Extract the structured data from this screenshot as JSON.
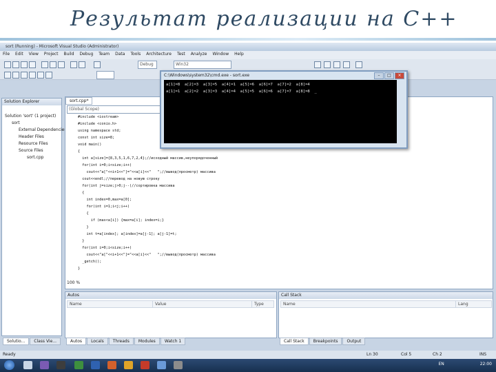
{
  "slide_title": "Результат реализации на С++",
  "window_title": "sort (Running) - Microsoft Visual Studio (Administrator)",
  "menu": [
    "File",
    "Edit",
    "View",
    "Project",
    "Build",
    "Debug",
    "Team",
    "Data",
    "Tools",
    "Architecture",
    "Test",
    "Analyze",
    "Window",
    "Help"
  ],
  "toolbar": {
    "config": "Debug",
    "platform": "Win32"
  },
  "solution_explorer": {
    "title": "Solution Explorer",
    "items": [
      "Solution 'sort' (1 project)",
      "sort",
      "External Dependencies",
      "Header Files",
      "Resource Files",
      "Source Files",
      "sort.cpp"
    ]
  },
  "editor": {
    "tab": "sort.cpp*",
    "scope": "(Global Scope)",
    "zoom": "100 %",
    "lines": [
      "#include <iostream>",
      "#include <conio.h>",
      "using namespace std;",
      "const int size=8;",
      "void main()",
      "{",
      "  int a[size]={8,3,5,1,6,7,2,4};//исходный массив,неупорядоченный",
      "  for(int i=0;i<size;i++)",
      "    cout<<\"a[\"<<i+1<<\"]=\"<<a[i]<<\"   \";//вывод(просмотр) массива",
      "  cout<<endl;//перевод на новую строку",
      "  for(int j=size;j>0;j--)//сортировка массива",
      "  {",
      "    int index=0,max=a[0];",
      "    for(int i=1;i<j;i++)",
      "    {",
      "      if (max<a[i]) {max=a[i]; index=i;}",
      "    }",
      "    int t=a[index]; a[index]=a[j-1]; a[j-1]=t;",
      "  }",
      "  for(int i=0;i<size;i++)",
      "    cout<<\"a[\"<<i+1<<\"]=\"<<a[i]<<\"   \";//вывод(просмотр) массива",
      "  _getch();",
      "}"
    ]
  },
  "console": {
    "title": "C:\\Windows\\system32\\cmd.exe - sort.exe",
    "line1": "a[1]=8  a[2]=3  a[3]=5  a[4]=1  a[5]=6  a[6]=7  a[7]=2  a[8]=4",
    "line2": "a[1]=1  a[2]=2  a[3]=3  a[4]=4  a[5]=5  a[6]=6  a[7]=7  a[8]=8  _"
  },
  "autos": {
    "title": "Autos",
    "col_name": "Name",
    "col_value": "Value",
    "col_type": "Type"
  },
  "callstack": {
    "title": "Call Stack",
    "col_name": "Name",
    "col_lang": "Lang"
  },
  "bottom_tabs_left": [
    "Solutio...",
    "Class Vie..."
  ],
  "bottom_tabs_mid": [
    "Autos",
    "Locals",
    "Threads",
    "Modules",
    "Watch 1"
  ],
  "bottom_tabs_right": [
    "Call Stack",
    "Breakpoints",
    "Output"
  ],
  "status": {
    "ready": "Ready",
    "ln": "Ln 30",
    "col": "Col 5",
    "ch": "Ch 2",
    "ins": "INS"
  },
  "tray": {
    "lang": "EN",
    "time": "22:00"
  }
}
